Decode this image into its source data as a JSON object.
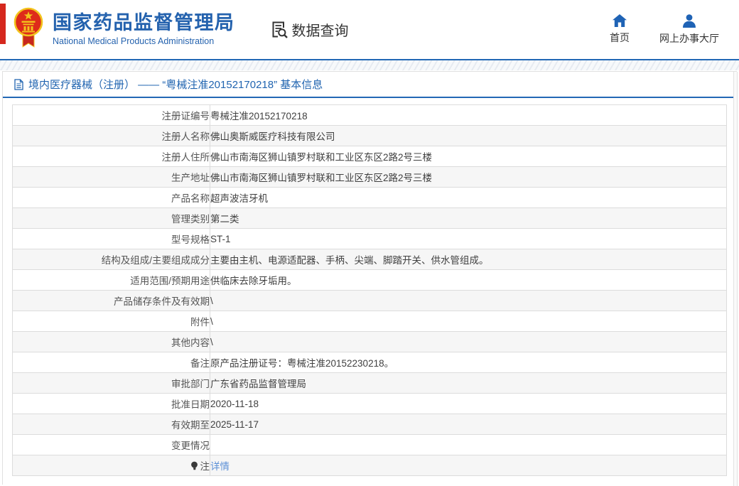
{
  "header": {
    "org_name_cn": "国家药品监督管理局",
    "org_name_en": "National Medical Products Administration",
    "data_query_label": "数据查询",
    "nav": [
      {
        "label": "首页",
        "icon": "home-icon"
      },
      {
        "label": "网上办事大厅",
        "icon": "user-icon"
      }
    ]
  },
  "breadcrumb": {
    "text": "境内医疗器械（注册） —— “粤械注准20152170218” 基本信息",
    "icon": "document-icon"
  },
  "table": {
    "rows": [
      {
        "label": "注册证编号",
        "value": "粤械注准20152170218"
      },
      {
        "label": "注册人名称",
        "value": "佛山奥斯威医疗科技有限公司"
      },
      {
        "label": "注册人住所",
        "value": "佛山市南海区狮山镇罗村联和工业区东区2路2号三楼"
      },
      {
        "label": "生产地址",
        "value": "佛山市南海区狮山镇罗村联和工业区东区2路2号三楼"
      },
      {
        "label": "产品名称",
        "value": "超声波洁牙机"
      },
      {
        "label": "管理类别",
        "value": "第二类"
      },
      {
        "label": "型号规格",
        "value": "ST-1"
      },
      {
        "label": "结构及组成/主要组成成分",
        "value": "主要由主机、电源适配器、手柄、尖端、脚踏开关、供水管组成。"
      },
      {
        "label": "适用范围/预期用途",
        "value": "供临床去除牙垢用。"
      },
      {
        "label": "产品储存条件及有效期",
        "value": "\\"
      },
      {
        "label": "附件",
        "value": "\\"
      },
      {
        "label": "其他内容",
        "value": "\\"
      },
      {
        "label": "备注",
        "value": "原产品注册证号：粤械注准20152230218。"
      },
      {
        "label": "审批部门",
        "value": "广东省药品监督管理局"
      },
      {
        "label": "批准日期",
        "value": "2020-11-18"
      },
      {
        "label": "有效期至",
        "value": "2025-11-17"
      },
      {
        "label": "变更情况",
        "value": ""
      },
      {
        "label": "注",
        "value": "详情",
        "label_icon": "bulb-icon",
        "value_is_link": true
      }
    ]
  },
  "colors": {
    "brand_blue": "#2462ae",
    "line_blue": "#2268b5",
    "link_blue": "#5b8fd6",
    "emblem_red": "#de2b1a",
    "emblem_gold": "#f2c41d",
    "alt_row": "#f6f6f6",
    "table_border": "#dcdcdc"
  }
}
